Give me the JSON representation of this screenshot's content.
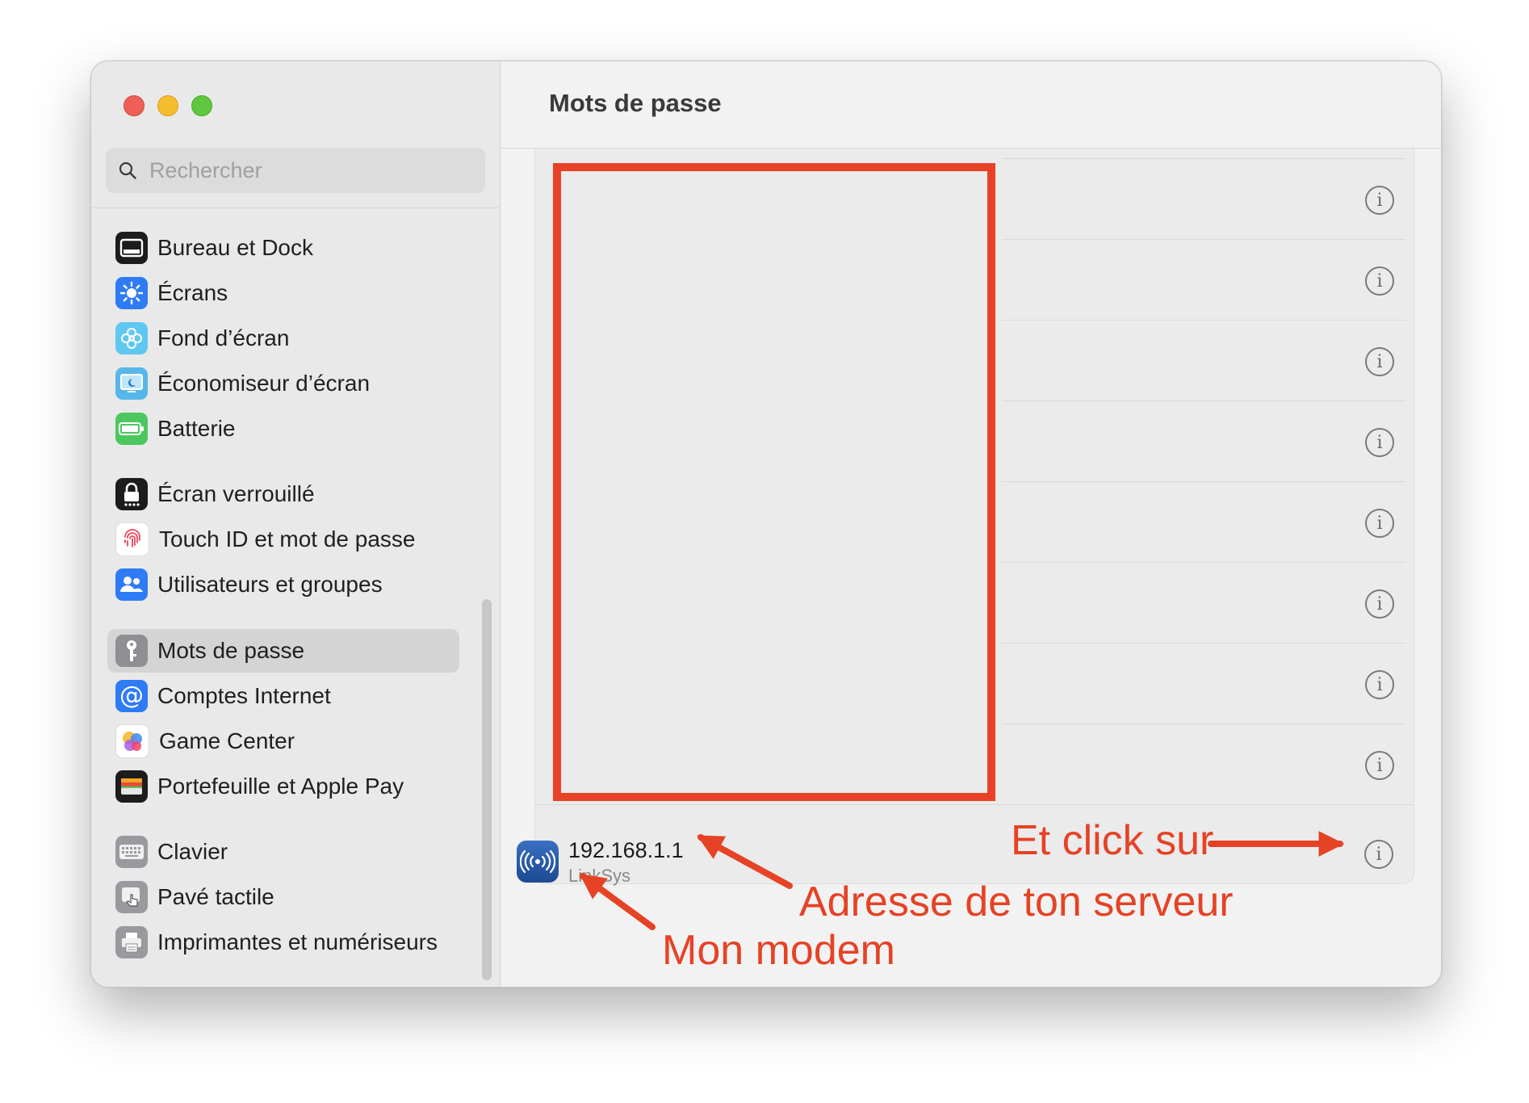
{
  "search": {
    "placeholder": "Rechercher"
  },
  "header": {
    "title": "Mots de passe"
  },
  "sidebar": {
    "items": [
      {
        "label": "Bureau et Dock",
        "icon": "dock-icon",
        "color": "#1c1c1e"
      },
      {
        "label": "Écrans",
        "icon": "brightness-icon",
        "color": "#2f7bf5"
      },
      {
        "label": "Fond d’écran",
        "icon": "flower-icon",
        "color": "#5ec8f2"
      },
      {
        "label": "Économiseur d’écran",
        "icon": "screensaver-icon",
        "color": "#56b7e8"
      },
      {
        "label": "Batterie",
        "icon": "battery-icon",
        "color": "#4cc760"
      },
      {
        "label": "Écran verrouillé",
        "icon": "lock-icon",
        "color": "#1c1c1e"
      },
      {
        "label": "Touch ID et mot de passe",
        "icon": "fingerprint-icon",
        "color": "#ffffff"
      },
      {
        "label": "Utilisateurs et groupes",
        "icon": "users-icon",
        "color": "#2f7bf5"
      },
      {
        "label": "Mots de passe",
        "icon": "key-icon",
        "color": "#8e8e93",
        "selected": true
      },
      {
        "label": "Comptes Internet",
        "icon": "at-icon",
        "color": "#2f7bf5"
      },
      {
        "label": "Game Center",
        "icon": "game-center-icon",
        "color": "#ffffff"
      },
      {
        "label": "Portefeuille et Apple Pay",
        "icon": "wallet-icon",
        "color": "#1c1c1e"
      },
      {
        "label": "Clavier",
        "icon": "keyboard-icon",
        "color": "#9a9a9e"
      },
      {
        "label": "Pavé tactile",
        "icon": "trackpad-icon",
        "color": "#9a9a9e"
      },
      {
        "label": "Imprimantes et numériseurs",
        "icon": "printer-icon",
        "color": "#9a9a9e"
      }
    ]
  },
  "passwords": {
    "entry": {
      "title": "192.168.1.1",
      "subtitle": "LinkSys",
      "icon": "wifi-modem-icon"
    }
  },
  "help": {
    "label": "?"
  },
  "annotations": {
    "click": "Et click sur",
    "server": "Adresse de ton serveur",
    "modem": "Mon modem",
    "color": "#e64225"
  }
}
